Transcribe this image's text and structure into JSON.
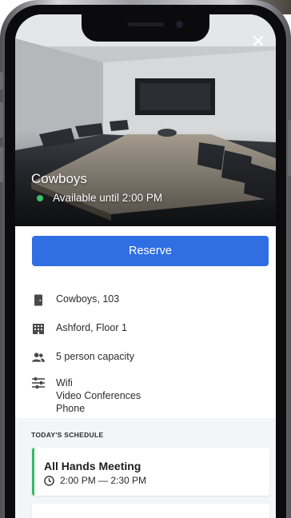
{
  "hero": {
    "room_name": "Cowboys",
    "availability": "Available until 2:00 PM",
    "close_glyph": "✕"
  },
  "details": {
    "reserve_label": "Reserve",
    "room_number": "Cowboys, 103",
    "location": "Ashford, Floor 1",
    "capacity": "5 person capacity",
    "amenities": [
      "Wifi",
      "Video Conferences",
      "Phone"
    ]
  },
  "schedule": {
    "title": "TODAY'S SCHEDULE",
    "events": [
      {
        "title": "All Hands Meeting",
        "time": "2:00 PM — 2:30 PM"
      }
    ]
  },
  "icons": {
    "close": "close-icon",
    "door": "door-icon",
    "building": "building-icon",
    "people": "people-icon",
    "amenities": "sliders-icon",
    "clock": "clock-icon"
  },
  "colors": {
    "primary": "#2f6fe3",
    "available": "#37c26a",
    "event_accent": "#36b864"
  }
}
